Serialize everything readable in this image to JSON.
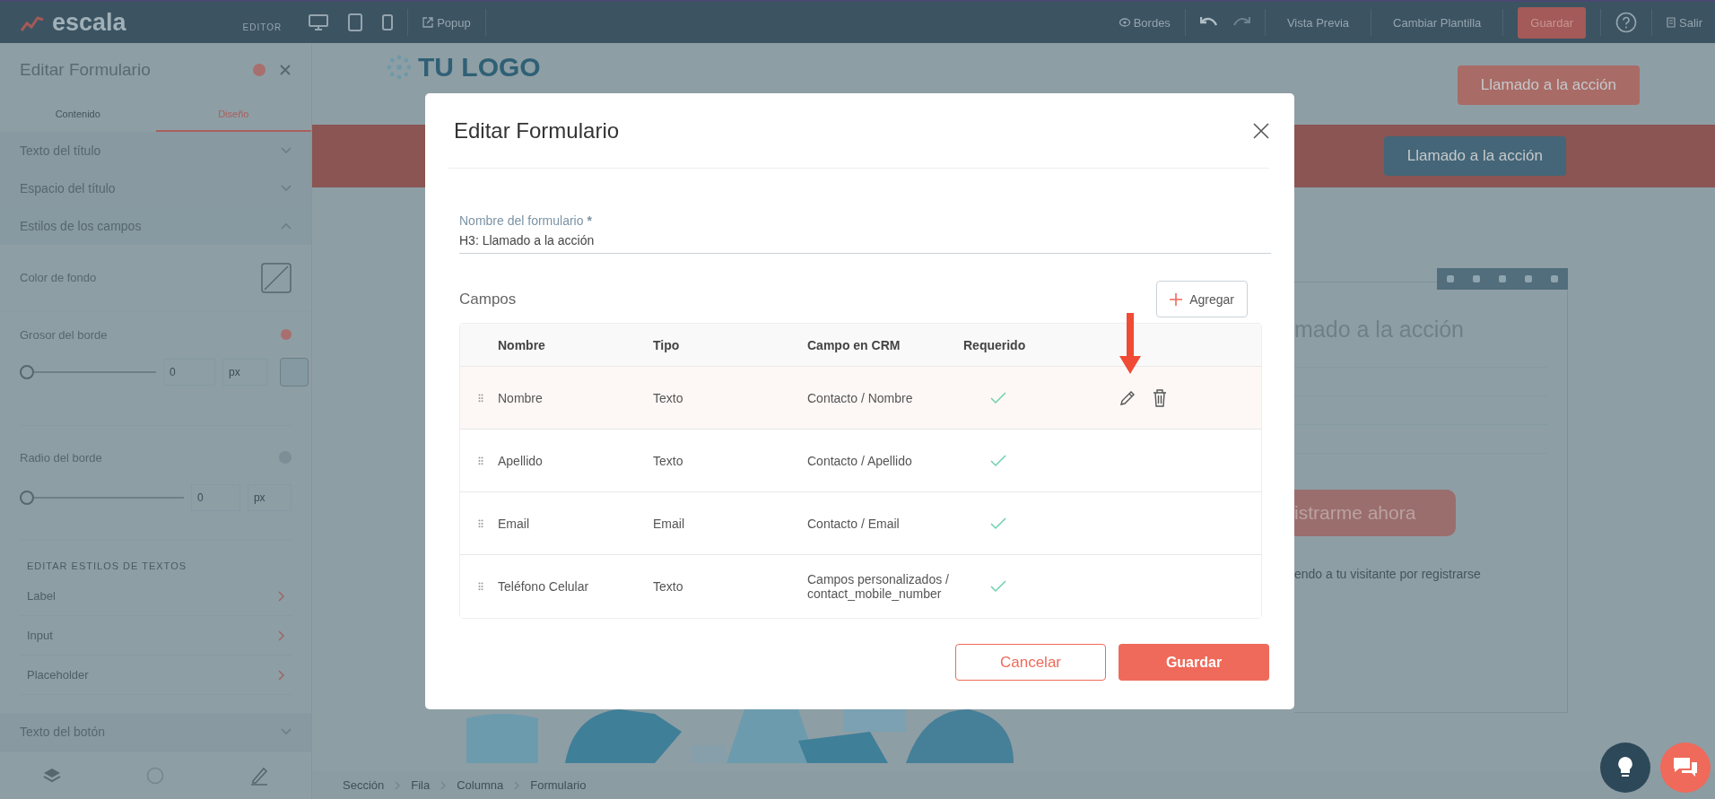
{
  "top_bar": {
    "logo": "escala",
    "mode": "EDITOR",
    "popup": "Popup",
    "borders": "Bordes",
    "preview": "Vista Previa",
    "change_template": "Cambiar Plantilla",
    "save": "Guardar",
    "exit": "Salir"
  },
  "side_panel": {
    "title": "Editar Formulario",
    "tabs": [
      {
        "label": "Contenido",
        "selected": false
      },
      {
        "label": "Diseño",
        "selected": true
      }
    ],
    "sections_top": [
      {
        "label": "Texto del título",
        "expanded": false
      },
      {
        "label": "Espacio del título",
        "expanded": false
      },
      {
        "label": "Estilos de los campos",
        "expanded": true
      }
    ],
    "background_color_label": "Color de fondo",
    "border_width": {
      "label": "Grosor del borde",
      "level": 0,
      "value": "0",
      "unit": "px"
    },
    "border_radius": {
      "label": "Radio del borde",
      "level": 0,
      "value": "0",
      "unit": "px"
    },
    "text_styles_heading": "EDITAR ESTILOS DE TEXTOS",
    "text_styles": [
      "Label",
      "Input",
      "Placeholder"
    ],
    "sections_bottom": [
      {
        "label": "Texto del botón",
        "expanded": false
      }
    ]
  },
  "canvas": {
    "logo": "TU LOGO",
    "header_button": "Llamado a la acción",
    "band_button": "Llamado a la acción",
    "form_heading": "mado a la acción",
    "form_button": "istrarme ahora",
    "form_note": "endo a tu visitante por registrarse",
    "breadcrumb": [
      "Sección",
      "Fila",
      "Columna",
      "Formulario"
    ]
  },
  "modal": {
    "title": "Editar Formulario",
    "name_label": "Nombre del formulario",
    "required_mark": "*",
    "name_value": "H3: Llamado a la acción",
    "fields_heading": "Campos",
    "add_button": "Agregar",
    "columns": [
      "Nombre",
      "Tipo",
      "Campo en CRM",
      "Requerido"
    ],
    "rows": [
      {
        "name": "Nombre",
        "type": "Texto",
        "crm_field": "Contacto / Nombre",
        "required": true,
        "hovered": true
      },
      {
        "name": "Apellido",
        "type": "Texto",
        "crm_field": "Contacto / Apellido",
        "required": true,
        "hovered": false
      },
      {
        "name": "Email",
        "type": "Email",
        "crm_field": "Contacto / Email",
        "required": true,
        "hovered": false
      },
      {
        "name": "Teléfono Celular",
        "type": "Texto",
        "crm_field": "Campos personalizados / contact_mobile_number",
        "required": true,
        "hovered": false
      }
    ],
    "cancel_button": "Cancelar",
    "save_button": "Guardar"
  }
}
